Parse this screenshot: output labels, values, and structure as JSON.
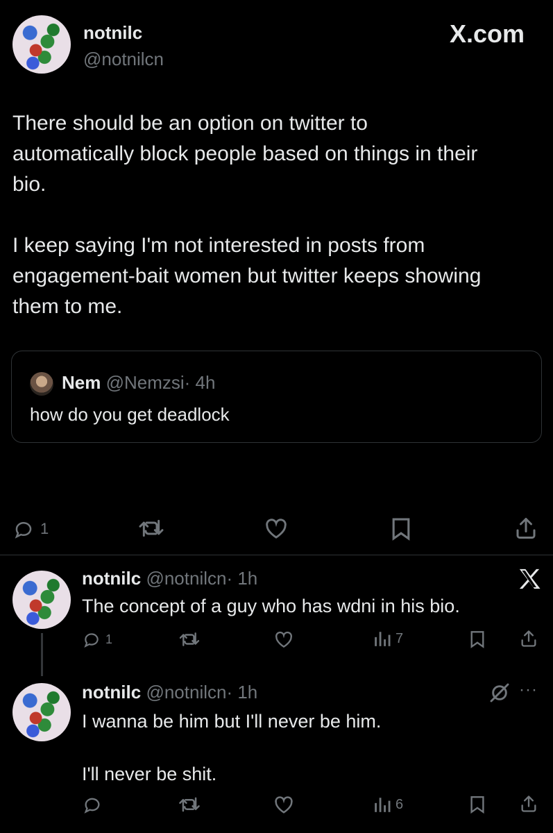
{
  "main_post": {
    "display_name": "notnilc",
    "handle": "@notnilcn",
    "watermark": "X.com",
    "body_lines": [
      "There should be an option on twitter to",
      "automatically block people based on things in their",
      "bio.",
      "",
      "I keep saying I'm not interested in posts from",
      "engagement-bait women but twitter keeps showing",
      "them to me."
    ],
    "quote": {
      "display_name": "Nem",
      "handle": "@Nemzsi",
      "time": "· 4h",
      "text": "how do you get deadlock"
    },
    "actions": {
      "reply_count": "1"
    }
  },
  "reply1": {
    "display_name": "notnilc",
    "handle": "@notnilcn",
    "time": "· 1h",
    "text": "The concept of a guy who has wdni in his bio.",
    "reply_count": "1",
    "view_count": "7"
  },
  "reply2": {
    "display_name": "notnilc",
    "handle": "@notnilcn",
    "time": "· 1h",
    "text_lines": [
      "I wanna be him but I'll never be him.",
      "",
      "I'll never be shit."
    ],
    "view_count": "6",
    "more": "···"
  },
  "icons": [
    "reply-icon",
    "retweet-icon",
    "like-icon",
    "bookmark-icon",
    "share-icon",
    "views-icon",
    "x-logo-icon",
    "grok-icon",
    "more-icon"
  ],
  "colors": {
    "background": "#000000",
    "text": "#e7e9ea",
    "muted": "#71767b",
    "border": "#2f3336"
  }
}
